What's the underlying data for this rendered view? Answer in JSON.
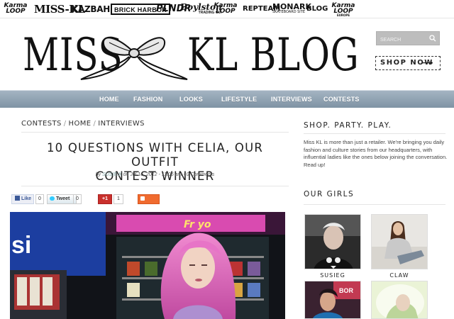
{
  "brand_bar": {
    "karmaloop_1": [
      "Karma",
      "LOOP"
    ],
    "misskl": "MISS-KL",
    "kazbah": "KAZBAH",
    "brickharbor": "BRICK HARBOR",
    "pl_ndr": "PLNDR",
    "boylston": "Boylston",
    "boylston_sub": "TRADING CO.",
    "karmaloop_2": [
      "Karma",
      "LOOP"
    ],
    "repteam": "REPTEAM",
    "monark": "MONARK",
    "monark_sub": "SKATEBOARD SITE",
    "blog": "BLOG",
    "karmaloop_3": [
      "Karma",
      "LOOP"
    ],
    "karmaloop_3_sub": "EUROPE"
  },
  "header": {
    "logo_left": "MISS",
    "logo_right": "KL BLOG",
    "search_placeholder": "SEARCH",
    "shop_now": "SHOP NOW",
    "shop_arrow": "⟶"
  },
  "nav": {
    "items": [
      "HOME",
      "FASHION",
      "LOOKS",
      "LIFESTYLE",
      "INTERVIEWS",
      "CONTESTS"
    ]
  },
  "post": {
    "breadcrumbs": [
      "CONTESTS",
      "HOME",
      "INTERVIEWS"
    ],
    "breadcrumb_sep": "/",
    "title_line1": "10 QUESTIONS WITH CELIA, OUR OUTFIT",
    "title_line2": "CONTEST WINNER",
    "byline_by": "by",
    "author": "SUSIE.K",
    "date": "on Jul 16, 2012 - 11:05 am -",
    "comments": "0 Comments"
  },
  "share": {
    "like_label": "Like",
    "like_count": "0",
    "tweet_label": "Tweet",
    "tweet_count": "0",
    "gplus_label": "+1",
    "gplus_count": "1",
    "share_label": "Share"
  },
  "sidebar": {
    "tagline": "SHOP. PARTY. PLAY.",
    "about": "Miss KL is more than just a retailer. We're bringing you daily fashion and culture stories from our headquarters, with influential ladies like the ones below joining the conversation. Read up!",
    "girls_heading": "OUR GIRLS",
    "girls": [
      "SUSIEG",
      "CLAW"
    ]
  }
}
